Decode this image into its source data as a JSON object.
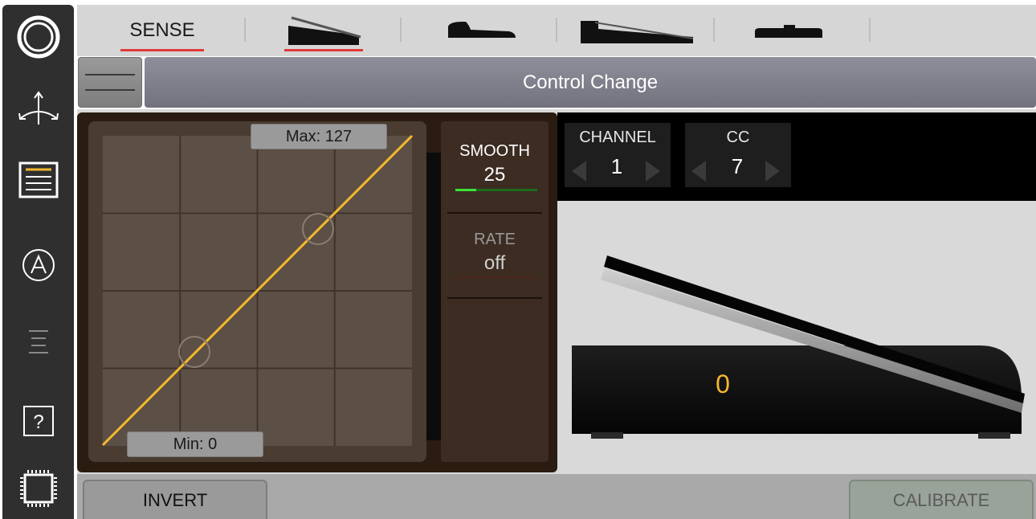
{
  "sidebar": {
    "items": [
      {
        "icon": "power-ring-icon"
      },
      {
        "icon": "routing-arrows-icon"
      },
      {
        "icon": "settings-list-icon"
      },
      {
        "icon": "auto-a-icon"
      },
      {
        "icon": "menu-lines-icon"
      },
      {
        "icon": "help-question-icon"
      },
      {
        "icon": "chip-icon"
      }
    ]
  },
  "tabs": {
    "sense_label": "SENSE",
    "active_tab": "expression-pedal",
    "items": [
      {
        "icon": "expression-pedal-icon"
      },
      {
        "icon": "sustain-pedal-icon"
      },
      {
        "icon": "long-expression-pedal-icon"
      },
      {
        "icon": "switch-pedal-icon"
      }
    ]
  },
  "header": {
    "menu_icon": "hamburger-icon",
    "mode_label": "Control Change"
  },
  "curve": {
    "max_label": "Max: 127",
    "min_label": "Min: 0",
    "curve_color": "#f5b82e",
    "grid_rows": 4,
    "grid_cols": 4
  },
  "params": {
    "smooth_title": "SMOOTH",
    "smooth_value": "25",
    "smooth_level": 0.25,
    "rate_title": "RATE",
    "rate_value": "off"
  },
  "midi": {
    "channel_title": "CHANNEL",
    "channel_value": "1",
    "cc_title": "CC",
    "cc_value": "7"
  },
  "pedal": {
    "value": "0",
    "value_color": "#f5b82e"
  },
  "bottom": {
    "invert_label": "INVERT",
    "calibrate_label": "CALIBRATE"
  },
  "colors": {
    "accent_red": "#e03a3a",
    "smooth_green": "#39e339"
  }
}
